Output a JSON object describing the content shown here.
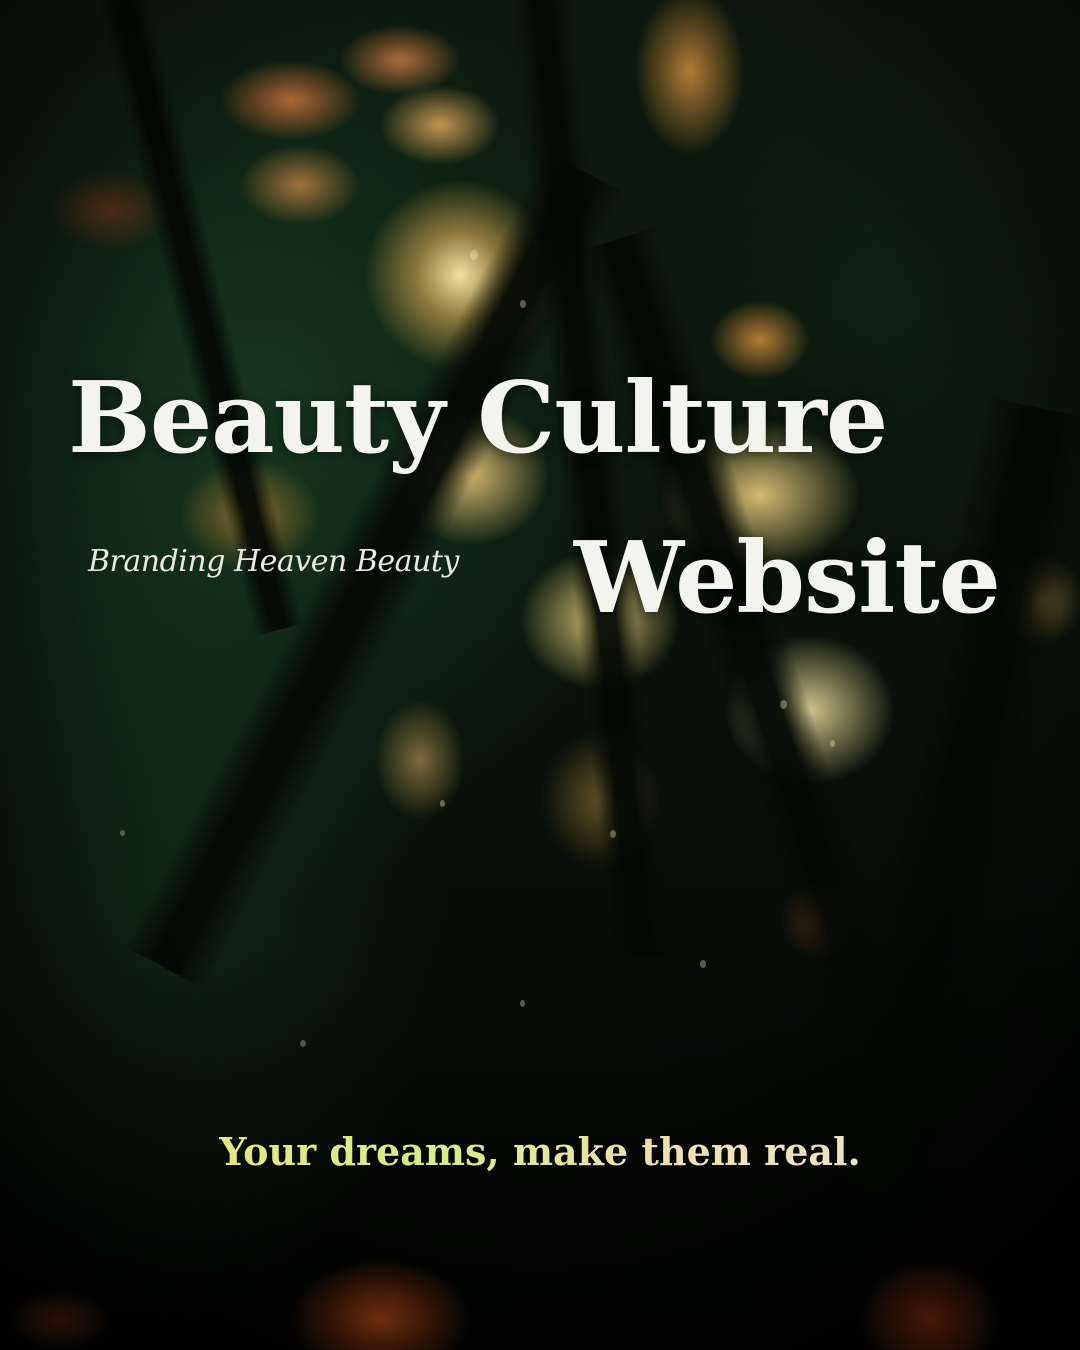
{
  "title": {
    "line1": "Beauty Culture",
    "line2": "Website"
  },
  "script_tag": "Branding Heaven Beauty",
  "tagline": "Your dreams, make them real.",
  "colors": {
    "title_text": "#f4f4ee",
    "tagline_start": "#f3e27a",
    "tagline_end": "#ece6dd",
    "background": "#050805"
  }
}
